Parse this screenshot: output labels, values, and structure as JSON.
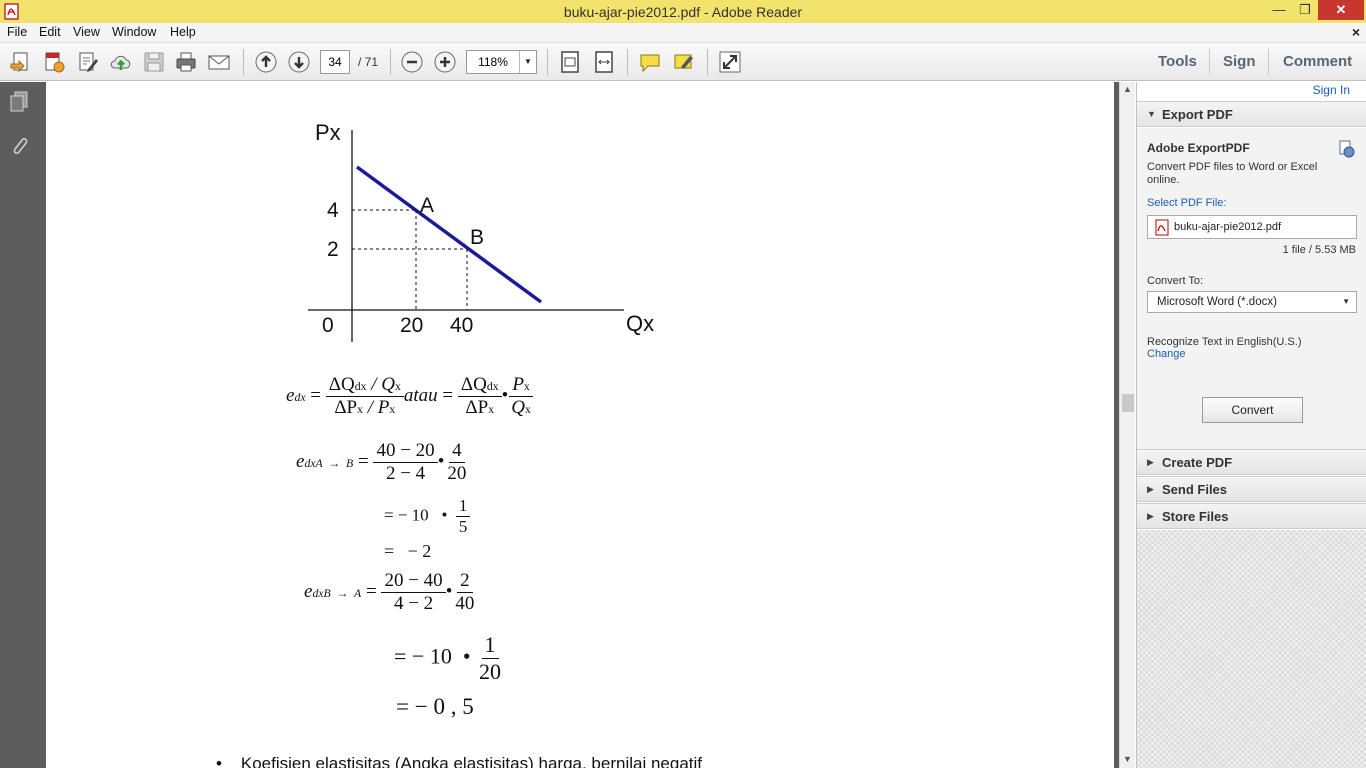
{
  "window": {
    "title": "buku-ajar-pie2012.pdf - Adobe Reader",
    "minimize": "—",
    "maximize": "❐",
    "close": "✕"
  },
  "menu": {
    "items": [
      "File",
      "Edit",
      "View",
      "Window",
      "Help"
    ],
    "close_doc": "×"
  },
  "toolbar": {
    "page_current": "34",
    "page_total": "/ 71",
    "zoom": "118%",
    "right_tools": [
      "Tools",
      "Sign",
      "Comment"
    ]
  },
  "document": {
    "graph": {
      "y_axis_label": "Px",
      "x_axis_label": "Qx",
      "origin_label": "0",
      "y_ticks": [
        "4",
        "2"
      ],
      "x_ticks": [
        "20",
        "40"
      ],
      "points": [
        {
          "label": "A",
          "q": 20,
          "p": 4
        },
        {
          "label": "B",
          "q": 40,
          "p": 2
        }
      ]
    },
    "formula": {
      "e": "e",
      "dx": "dx",
      "eq": "=",
      "num1": "ΔQ",
      "num1_sub": "dx",
      "num1_tail": " / Q",
      "num1_tail_sub": "x",
      "den1": "ΔP",
      "den1_sub": "x",
      "den1_tail": " / P",
      "den1_tail_sub": "x",
      "atau": "atau",
      "num2": "ΔQ",
      "num2_sub": "dx",
      "den2": "ΔP",
      "den2_sub": "x",
      "dot": "•",
      "num3": "P",
      "num3_sub": "x",
      "den3": "Q",
      "den3_sub": "x"
    },
    "calc_ab": {
      "lhs": "e",
      "lhs_sub": "dxA  →  B",
      "eq": "=",
      "frac1_num": "40 − 20",
      "frac1_den": "2 − 4",
      "dot": "•",
      "frac2_num": "4",
      "frac2_den": "20",
      "line2_lhs": "= − 10",
      "line2_dot": "•",
      "line2_num": "1",
      "line2_den": "5",
      "line3": "=   − 2"
    },
    "calc_ba": {
      "lhs": "e",
      "lhs_sub": "dxB  →  A",
      "eq": "=",
      "frac1_num": "20 − 40",
      "frac1_den": "4 − 2",
      "dot": "•",
      "frac2_num": "2",
      "frac2_den": "40",
      "line2_lhs": "= − 10",
      "line2_dot": "•",
      "line2_num": "1",
      "line2_den": "20",
      "line3": "= − 0 , 5"
    },
    "bullet": "Koefisien elastisitas (Angka elastisitas) harga, bernilai negatif"
  },
  "right_panel": {
    "sign_in": "Sign In",
    "export_pdf": {
      "header": "Export PDF",
      "title": "Adobe ExportPDF",
      "description": "Convert PDF files to Word or Excel online.",
      "select_label": "Select PDF File:",
      "file_name": "buku-ajar-pie2012.pdf",
      "file_info": "1 file / 5.53 MB",
      "convert_to_label": "Convert To:",
      "convert_to_value": "Microsoft Word (*.docx)",
      "recognize": "Recognize Text in English(U.S.)",
      "change": "Change",
      "convert_button": "Convert"
    },
    "sections": [
      "Create PDF",
      "Send Files",
      "Store Files"
    ]
  },
  "colors": {
    "title_bar": "#f1e36b",
    "demand_line": "#1a1a9a",
    "link": "#1a5fb4",
    "panel_gray": "#5d5d5d"
  }
}
